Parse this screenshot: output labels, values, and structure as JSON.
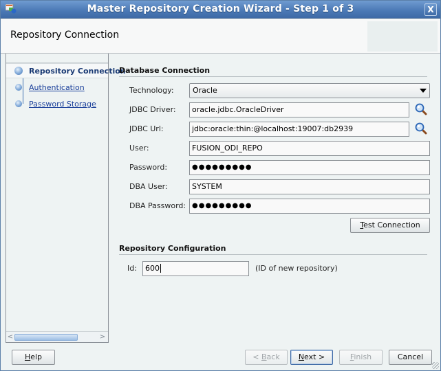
{
  "window": {
    "title": "Master Repository Creation Wizard - Step 1 of 3",
    "close_label": "X"
  },
  "header": {
    "title": "Repository Connection"
  },
  "steps": [
    {
      "label": "Repository Connection",
      "state": "current"
    },
    {
      "label": "Authentication",
      "state": "link"
    },
    {
      "label": "Password Storage",
      "state": "link"
    }
  ],
  "database_connection": {
    "section_title": "Database Connection",
    "technology": {
      "label": "Technology:",
      "value": "Oracle"
    },
    "jdbc_driver": {
      "label": "JDBC Driver:",
      "value": "oracle.jdbc.OracleDriver"
    },
    "jdbc_url": {
      "label": "JDBC Url:",
      "value": "jdbc:oracle:thin:@localhost:19007:db2939"
    },
    "user": {
      "label": "User:",
      "value": "FUSION_ODI_REPO"
    },
    "password": {
      "label": "Password:",
      "value": "●●●●●●●●●"
    },
    "dba_user": {
      "label": "DBA User:",
      "value": "SYSTEM"
    },
    "dba_password": {
      "label": "DBA Password:",
      "value": "●●●●●●●●●"
    },
    "test_button": {
      "mnemonic": "T",
      "rest": "est Connection"
    }
  },
  "repository_configuration": {
    "section_title": "Repository Configuration",
    "id": {
      "label": "Id:",
      "value": "600",
      "hint": "(ID of new repository)"
    }
  },
  "footer": {
    "help": {
      "mnemonic": "H",
      "rest": "elp"
    },
    "back": {
      "prefix": "< ",
      "mnemonic": "B",
      "rest": "ack"
    },
    "next": {
      "mnemonic": "N",
      "rest": "ext >"
    },
    "finish": {
      "mnemonic": "F",
      "rest": "inish"
    },
    "cancel": "Cancel"
  },
  "colors": {
    "titlebar": "#4a78b5",
    "link": "#1a3f9a",
    "panel_bg": "#eef3f3"
  }
}
